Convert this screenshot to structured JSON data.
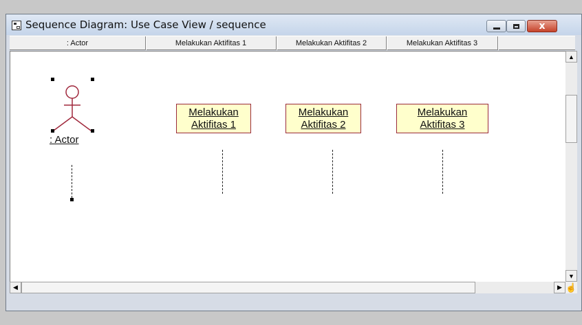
{
  "window": {
    "title": "Sequence Diagram: Use Case View / sequence",
    "minimize_label": "",
    "maximize_label": "",
    "close_label": "x"
  },
  "columns": [
    ": Actor",
    "Melakukan Aktifitas 1",
    "Melakukan Aktifitas 2",
    "Melakukan Aktifitas 3"
  ],
  "actor": {
    "label": ": Actor"
  },
  "objects": [
    {
      "line1": "Melakukan",
      "line2": "Aktifitas 1"
    },
    {
      "line1": "Melakukan",
      "line2": "Aktifitas 2"
    },
    {
      "line1": "Melakukan",
      "line2": "Aktifitas 3"
    }
  ],
  "scrollbars": {
    "up_icon": "▲",
    "down_icon": "▼",
    "left_icon": "◀",
    "right_icon": "▶",
    "hand_icon": "☝"
  },
  "colors": {
    "object_fill": "#ffffcc",
    "object_border": "#9a2a3a",
    "actor_stroke": "#a0283c"
  }
}
